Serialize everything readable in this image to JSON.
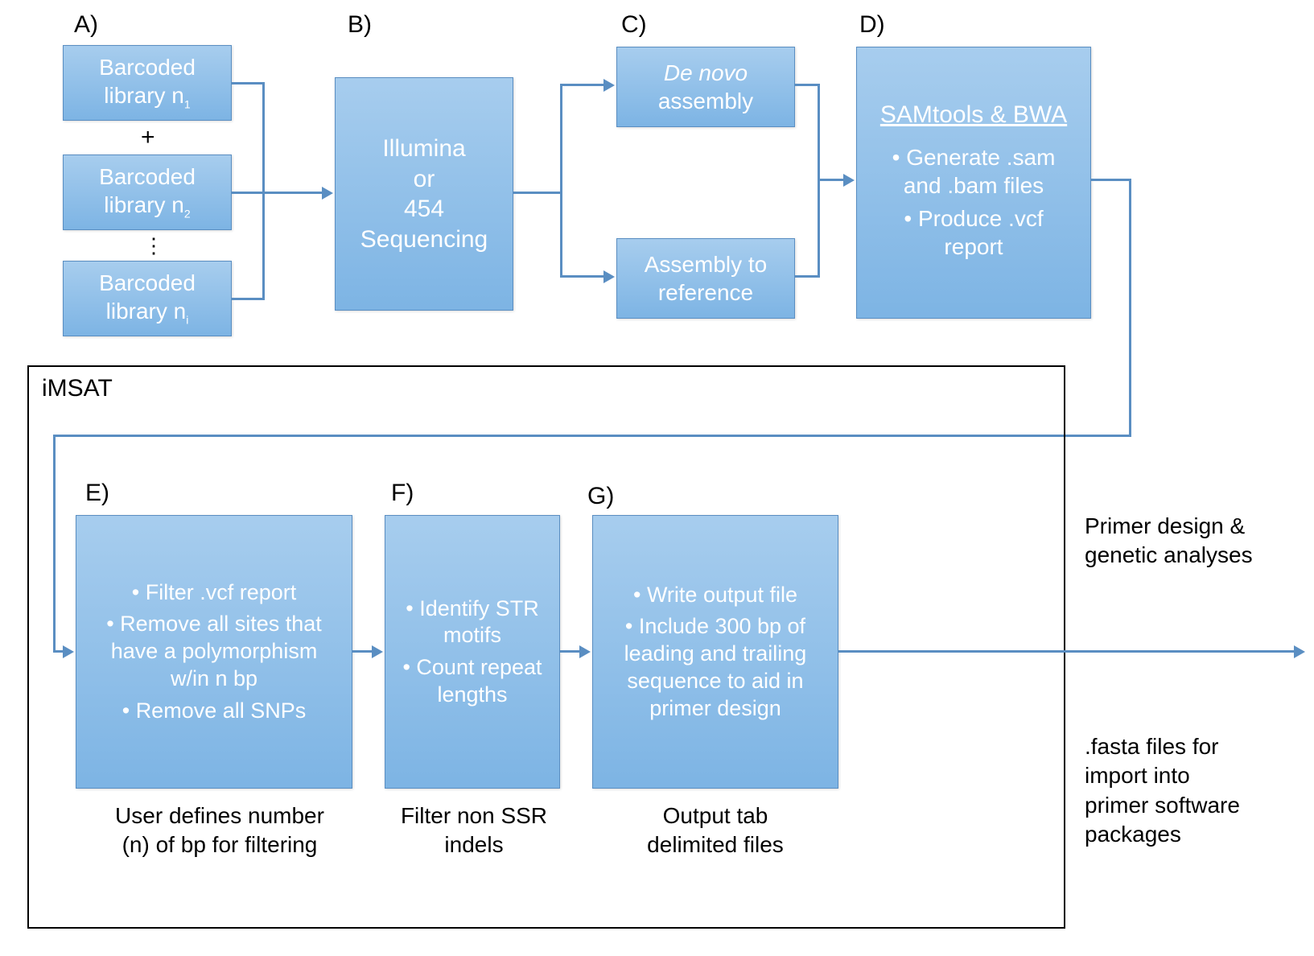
{
  "labels": {
    "A": "A)",
    "B": "B)",
    "C": "C)",
    "D": "D)",
    "E": "E)",
    "F": "F)",
    "G": "G)"
  },
  "boxes": {
    "lib1": {
      "line1": "Barcoded",
      "line2_prefix": "library n",
      "line2_sub": "1"
    },
    "plus": "+",
    "lib2": {
      "line1": "Barcoded",
      "line2_prefix": "library n",
      "line2_sub": "2"
    },
    "vdots": "⋮",
    "lib3": {
      "line1": "Barcoded",
      "line2_prefix": "library n",
      "line2_sub": "i"
    },
    "seq": {
      "l1": "Illumina",
      "l2": "or",
      "l3": "454",
      "l4": "Sequencing"
    },
    "denovo": {
      "l1": "De novo",
      "l2": "assembly"
    },
    "assref": {
      "l1": "Assembly to",
      "l2": "reference"
    },
    "samtools": {
      "title": "SAMtools & BWA",
      "b1": "Generate .sam and .bam files",
      "b2": "Produce .vcf report"
    },
    "E": {
      "b1": "Filter .vcf report",
      "b2": "Remove all sites that have a polymorphism w/in n bp",
      "b3": "Remove all SNPs"
    },
    "F": {
      "b1": "Identify STR motifs",
      "b2": "Count repeat lengths"
    },
    "G": {
      "b1": "Write output file",
      "b2": "Include 300 bp of leading and trailing sequence to aid in primer design"
    }
  },
  "captions": {
    "E": {
      "l1": "User defines number",
      "l2": "(n) of bp for filtering"
    },
    "F": {
      "l1": "Filter non SSR",
      "l2": "indels"
    },
    "G": {
      "l1": "Output tab",
      "l2": "delimited files"
    }
  },
  "right": {
    "top": {
      "l1": "Primer design &",
      "l2": "genetic analyses"
    },
    "bot": {
      "l1": ".fasta files for",
      "l2": "import into",
      "l3": "primer software",
      "l4": "packages"
    }
  },
  "frame": {
    "title": "iMSAT"
  }
}
